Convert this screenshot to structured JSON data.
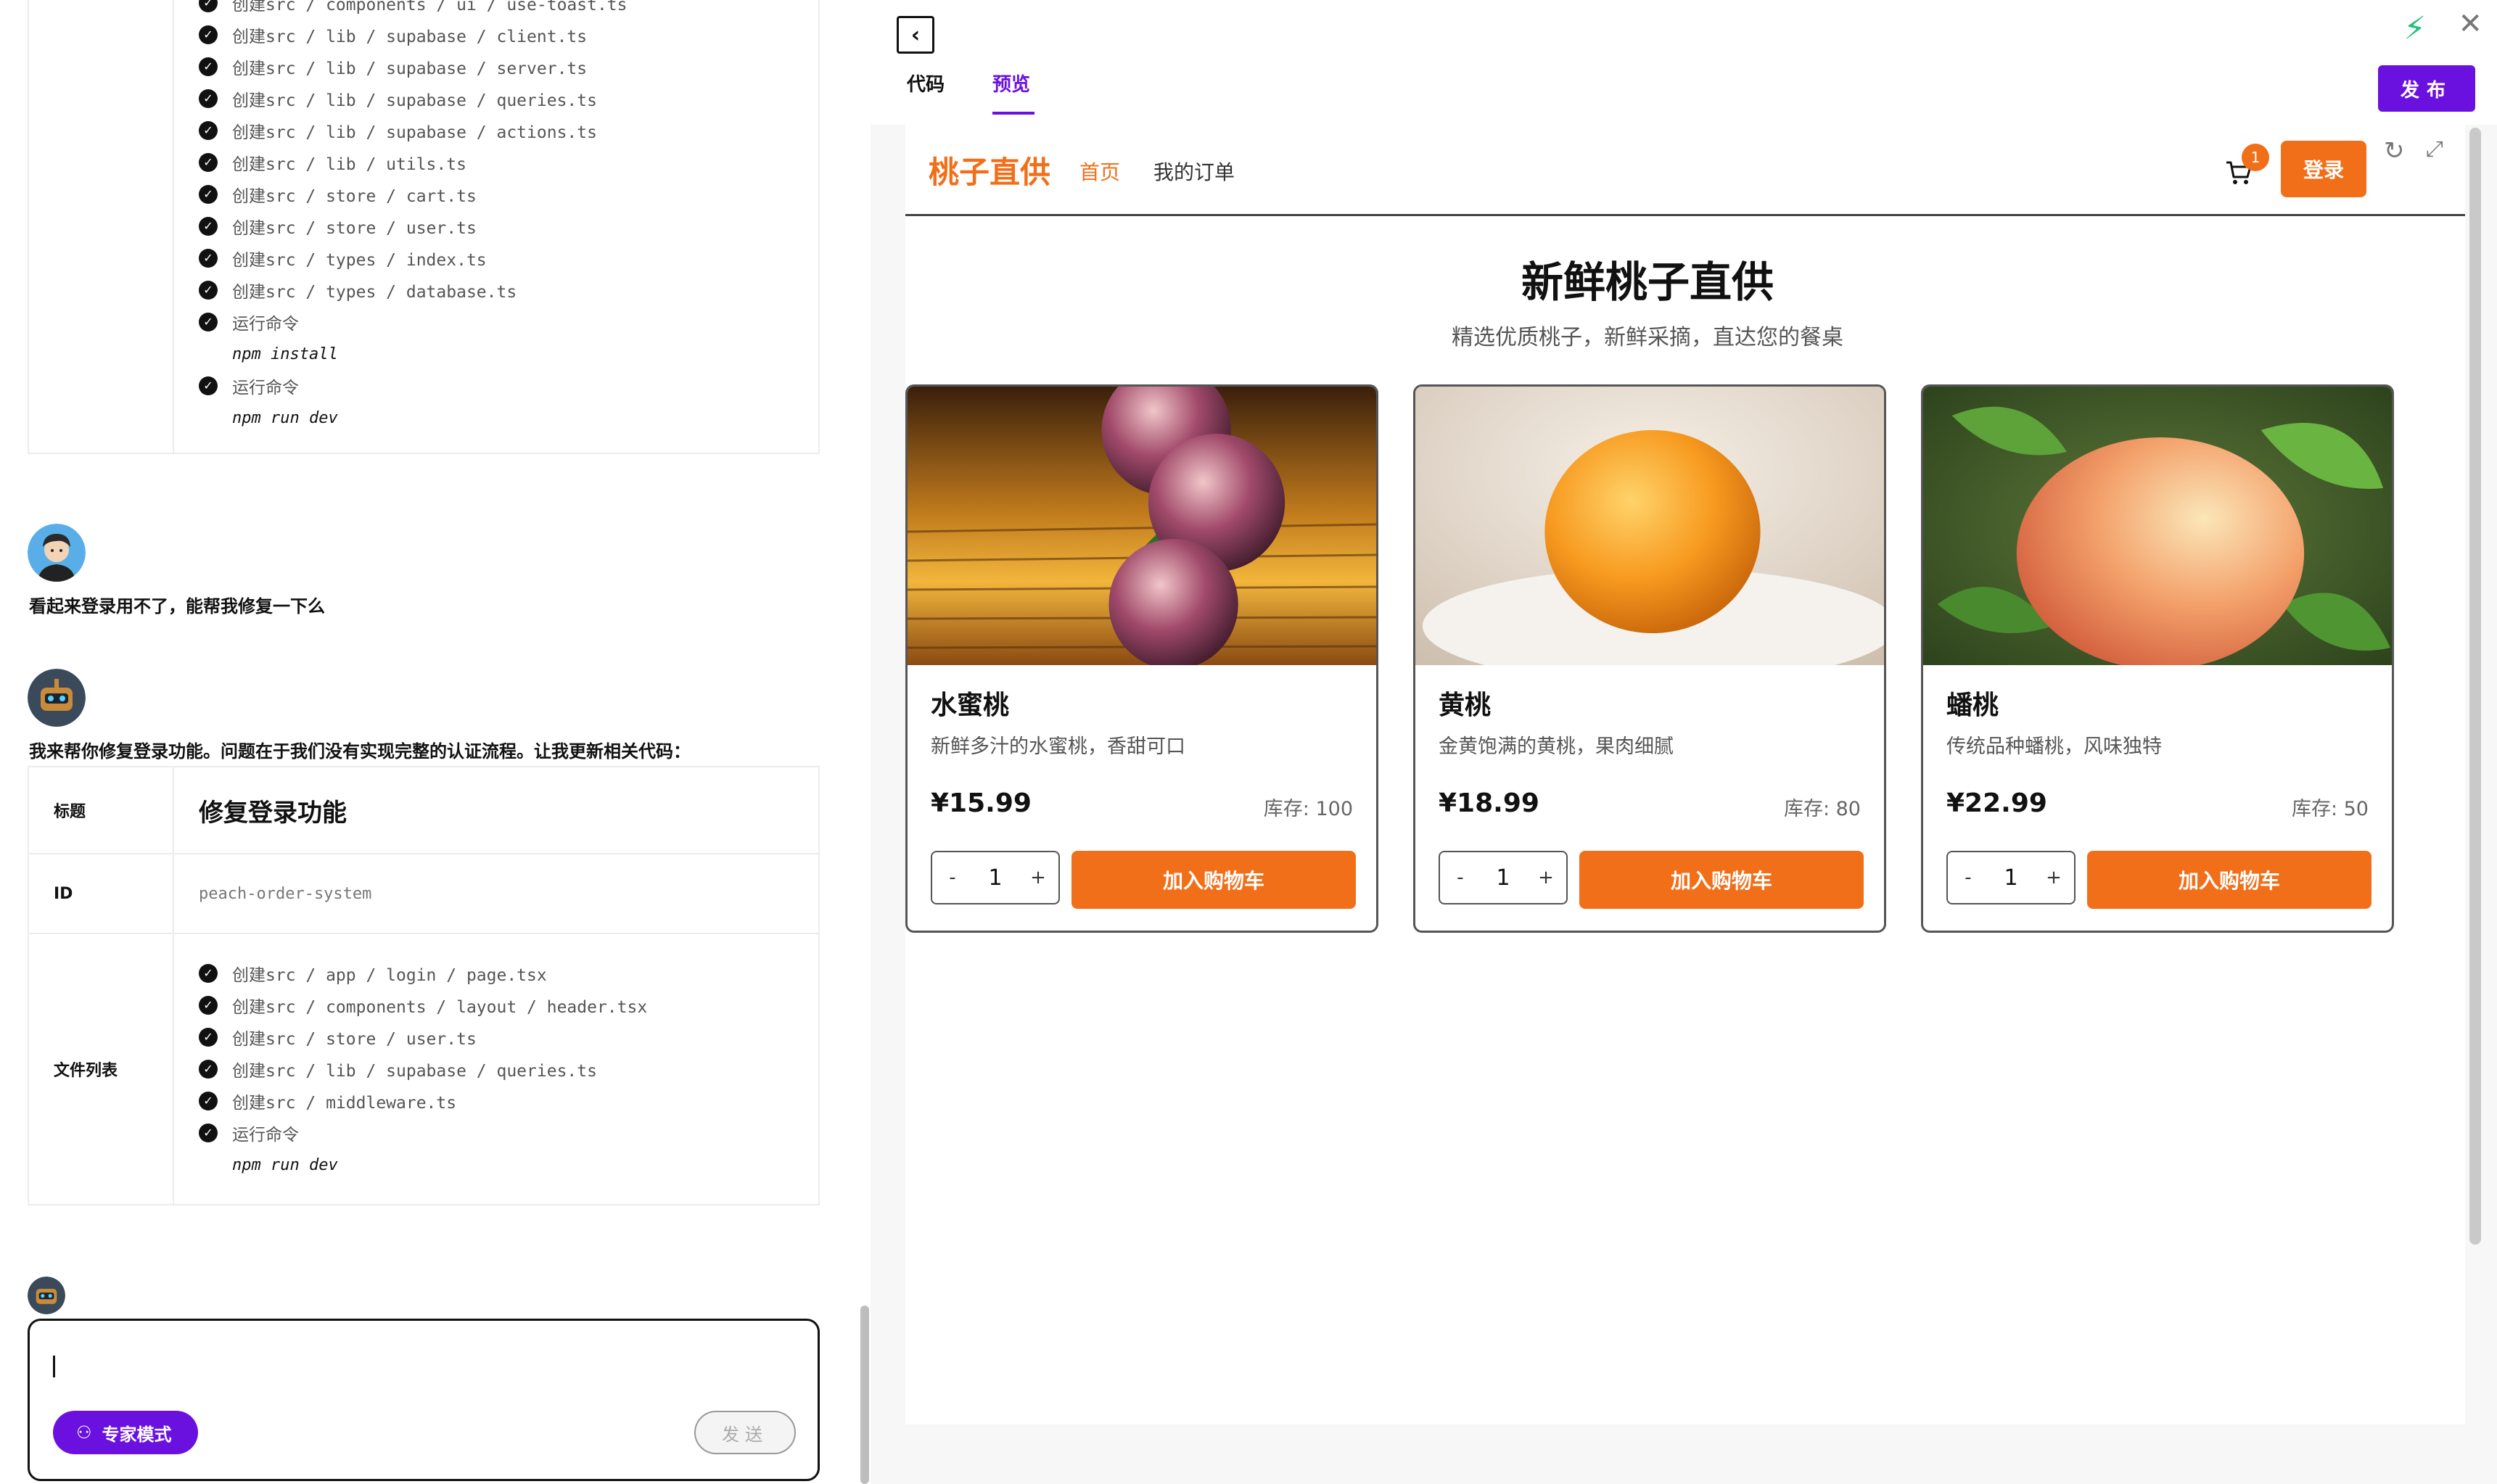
{
  "chat": {
    "file_table_1": {
      "steps": [
        "创建src / components / ui / use-toast.ts",
        "创建src / lib / supabase / client.ts",
        "创建src / lib / supabase / server.ts",
        "创建src / lib / supabase / queries.ts",
        "创建src / lib / supabase / actions.ts",
        "创建src / lib / utils.ts",
        "创建src / store / cart.ts",
        "创建src / store / user.ts",
        "创建src / types / index.ts",
        "创建src / types / database.ts"
      ],
      "run1_label": "运行命令",
      "run1_cmd": "npm install",
      "run2_label": "运行命令",
      "run2_cmd": "npm run dev"
    },
    "user_message": "看起来登录用不了，能帮我修复一下么",
    "assistant_message": "我来帮你修复登录功能。问题在于我们没有实现完整的认证流程。让我更新相关代码：",
    "file_table_2": {
      "title_key": "标题",
      "title_value": "修复登录功能",
      "id_key": "ID",
      "id_value": "peach-order-system",
      "files_key": "文件列表",
      "steps": [
        "创建src / app / login / page.tsx",
        "创建src / components / layout / header.tsx",
        "创建src / store / user.ts",
        "创建src / lib / supabase / queries.ts",
        "创建src / middleware.ts"
      ],
      "run_label": "运行命令",
      "run_cmd": "npm run dev"
    },
    "composer": {
      "expert_label": "专家模式",
      "send_label": "发送"
    }
  },
  "toolbar": {
    "tab_code": "代码",
    "tab_preview": "预览",
    "publish_label": "发布"
  },
  "preview": {
    "brand": "桃子直供",
    "nav_home": "首页",
    "nav_orders": "我的订单",
    "cart_count": "1",
    "login_label": "登录",
    "hero_title": "新鲜桃子直供",
    "hero_subtitle": "精选优质桃子，新鲜采摘，直达您的餐桌",
    "products": [
      {
        "name": "水蜜桃",
        "desc": "新鲜多汁的水蜜桃，香甜可口",
        "price": "¥15.99",
        "stock": "库存: 100",
        "qty": "1",
        "add_label": "加入购物车"
      },
      {
        "name": "黄桃",
        "desc": "金黄饱满的黄桃，果肉细腻",
        "price": "¥18.99",
        "stock": "库存: 80",
        "qty": "1",
        "add_label": "加入购物车"
      },
      {
        "name": "蟠桃",
        "desc": "传统品种蟠桃，风味独特",
        "price": "¥22.99",
        "stock": "库存: 50",
        "qty": "1",
        "add_label": "加入购物车"
      }
    ]
  },
  "colors": {
    "accent_purple": "#6a11e0",
    "accent_orange": "#f26f1a",
    "bolt_green": "#22c07a"
  },
  "icons": {
    "check": "check-circle-icon",
    "back": "chevron-left-icon",
    "bolt": "bolt-icon",
    "close": "close-icon",
    "cart": "cart-icon",
    "refresh": "refresh-icon",
    "expand": "expand-icon",
    "expert": "expert-icon"
  }
}
